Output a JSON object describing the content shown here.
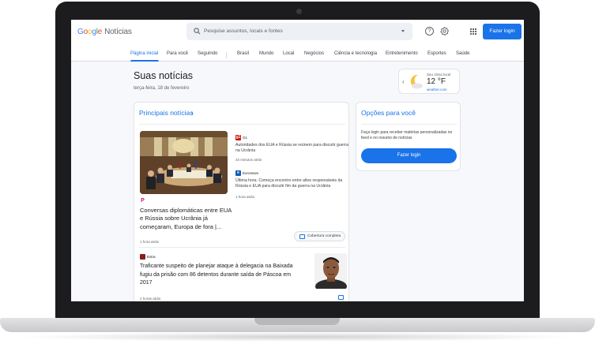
{
  "header": {
    "logo_google": "Google",
    "logo_product": "Notícias",
    "search_placeholder": "Pesquise assuntos, locais e fontes",
    "login_label": "Fazer login"
  },
  "nav": {
    "tabs": [
      "Página inicial",
      "Para você",
      "Seguindo",
      "Brasil",
      "Mundo",
      "Local",
      "Negócios",
      "Ciência e tecnologia",
      "Entretenimento",
      "Esportes",
      "Saúde"
    ]
  },
  "main": {
    "title": "Suas notícias",
    "date": "terça-feira, 18 de fevereiro"
  },
  "weather": {
    "label": "Seu clima local",
    "temp": "12 °F",
    "source": "weather.com"
  },
  "top_stories": {
    "title": "Principais notícias",
    "hero": {
      "publisher_letter": "P",
      "title": "Conversas diplomáticas entre EUA e Rússia sobre Ucrânia já começaram, Europa de fora |...",
      "time": "1 hora atrás"
    },
    "side_stories": [
      {
        "publisher": "G1",
        "publisher_letter": "g1",
        "title": "Autoridades dos EUA e Rússia se reúnem para discutir guerra na Ucrânia",
        "time": "34 minutos atrás"
      },
      {
        "publisher": "Euronews",
        "publisher_letter": "e",
        "title": "Última hora. Começa encontro entre altos responsáveis da Rússia e EUA para discutir fim da guerra na Ucrânia",
        "time": "1 hora atrás"
      }
    ],
    "coverage_label": "Cobertura completa",
    "story2": {
      "publisher": "Extra",
      "title": "Traficante suspeito de planejar ataque à delegacia na Baixada fugiu da prisão com 86 detentos durante saída de Páscoa em 2017",
      "time": "2 horas atrás"
    }
  },
  "for_you": {
    "title": "Opções para você",
    "text": "Faça login para receber matérias personalizadas no feed e no resumo de notícias",
    "button": "Fazer login"
  },
  "colors": {
    "accent": "#1a73e8",
    "laptop_bezel": "#1c1c1e",
    "page_bg": "#f6f8fc"
  }
}
